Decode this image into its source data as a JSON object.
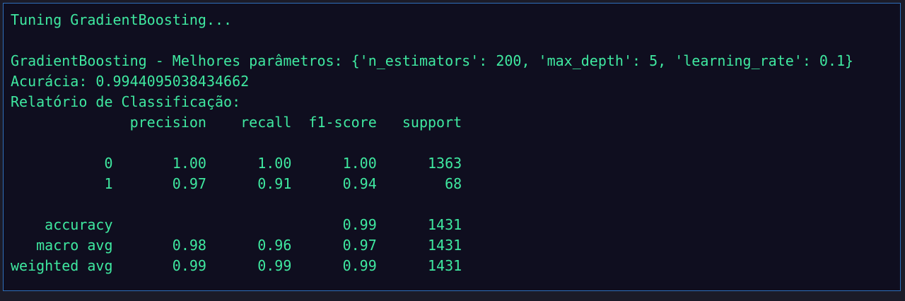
{
  "colors": {
    "background": "#0f0e1f",
    "text": "#3fe8a0",
    "border": "#2f6fba"
  },
  "output": {
    "lines": [
      "Tuning GradientBoosting...",
      "",
      "GradientBoosting - Melhores parâmetros: {'n_estimators': 200, 'max_depth': 5, 'learning_rate': 0.1}",
      "Acurácia: 0.9944095038434662",
      "Relatório de Classificação:",
      "              precision    recall  f1-score   support",
      "",
      "           0       1.00      1.00      1.00      1363",
      "           1       0.97      0.91      0.94        68",
      "",
      "    accuracy                           0.99      1431",
      "   macro avg       0.98      0.96      0.97      1431",
      "weighted avg       0.99      0.99      0.99      1431"
    ]
  }
}
